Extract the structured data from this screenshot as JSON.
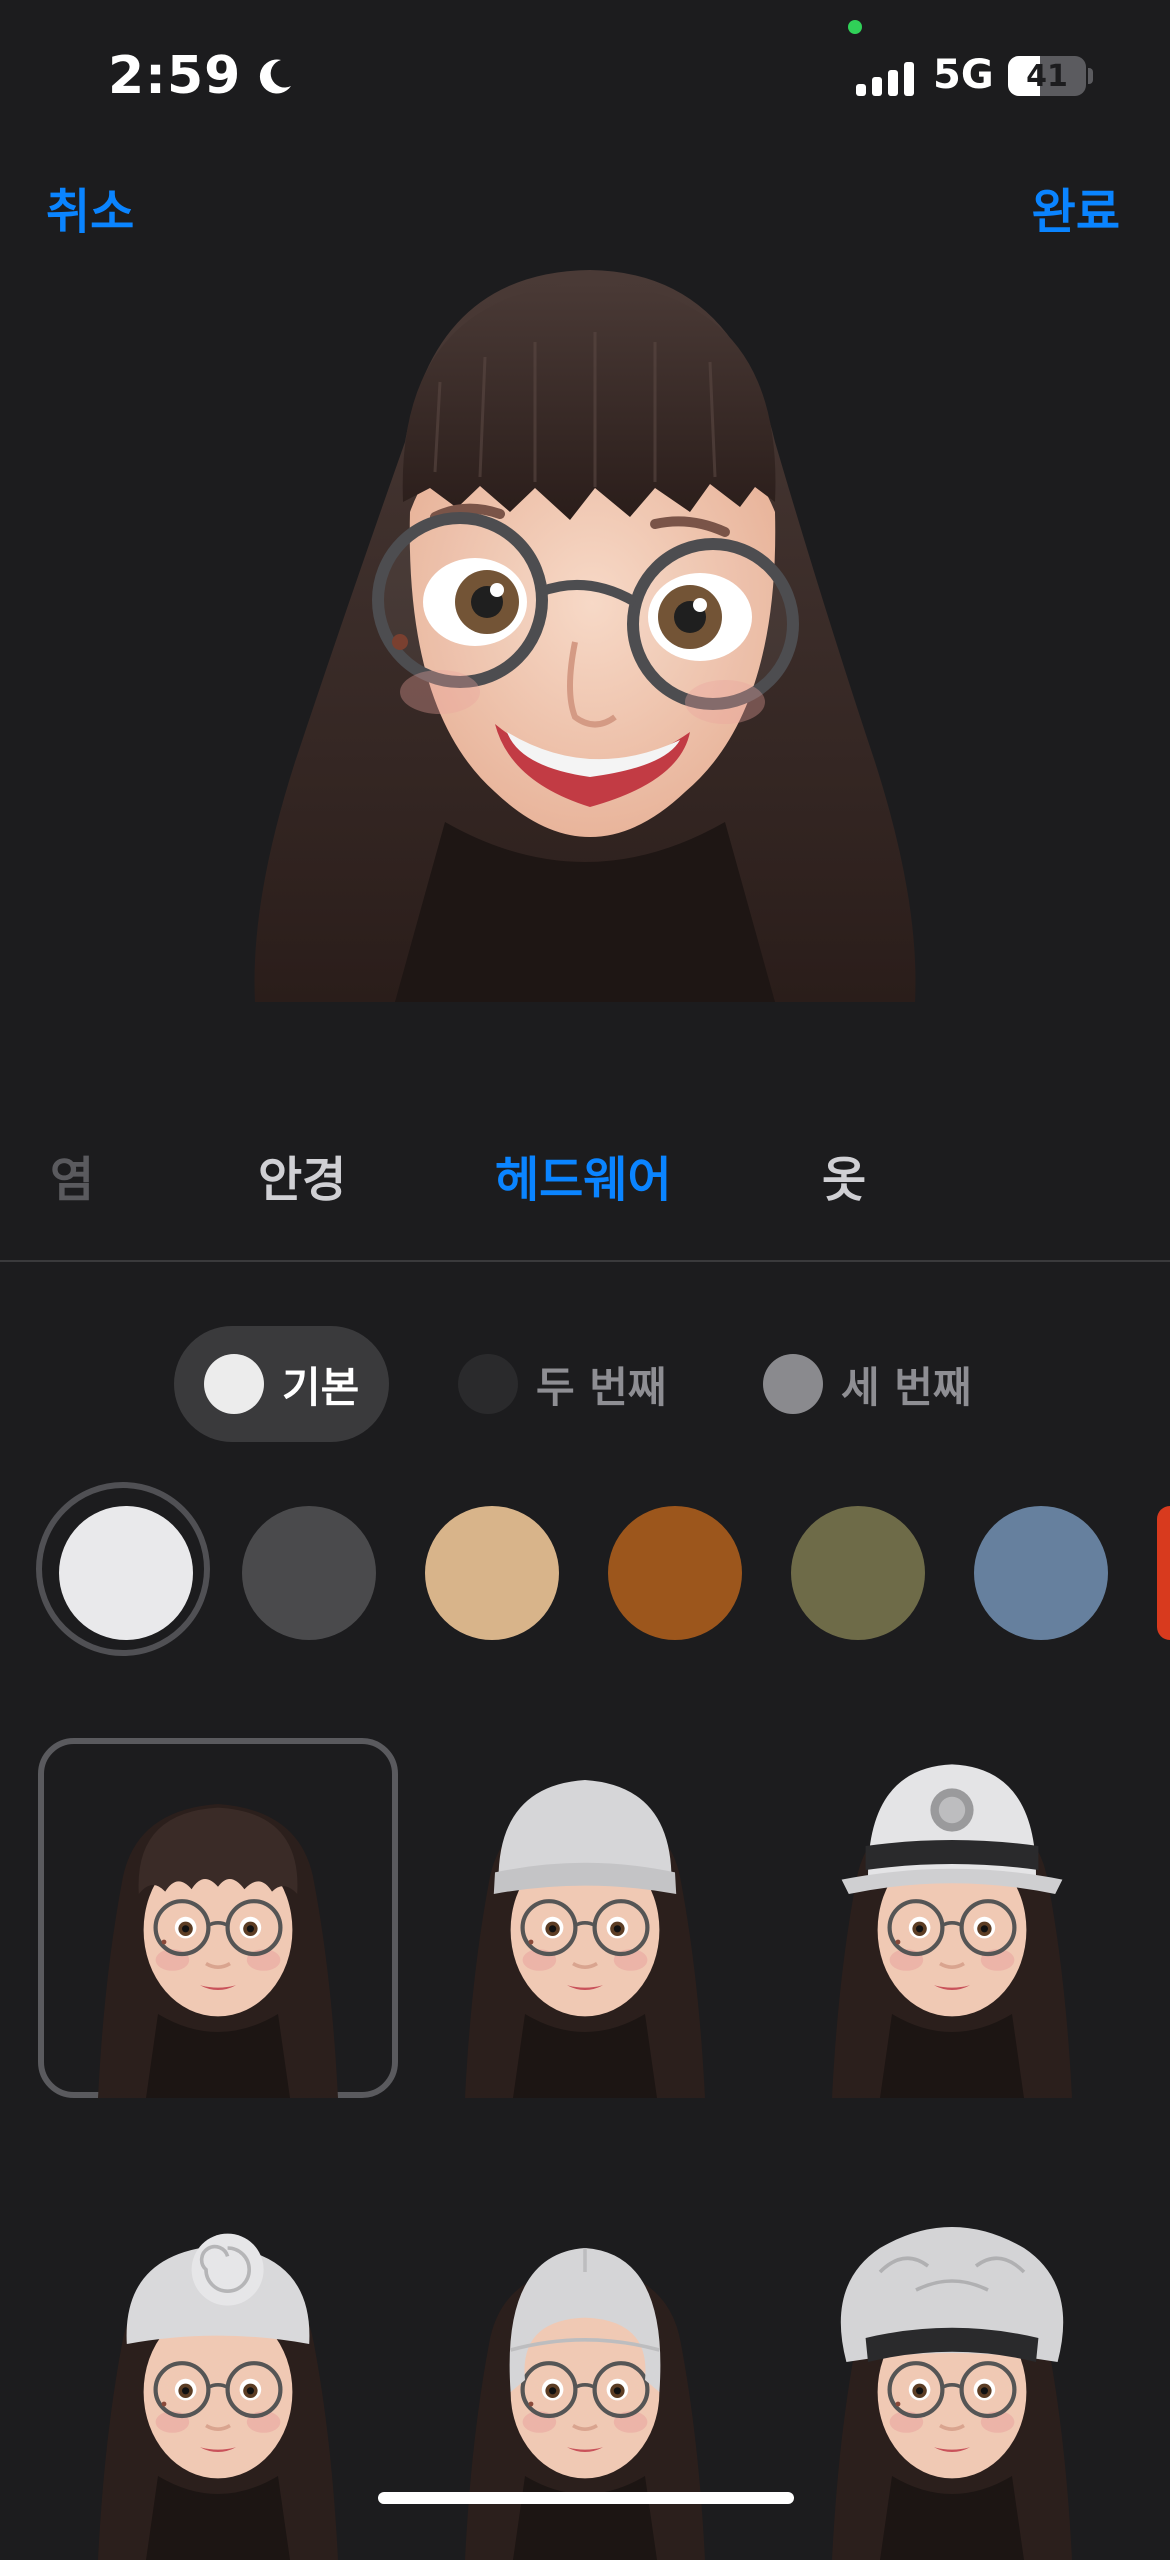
{
  "status_bar": {
    "time": "2:59",
    "network": "5G",
    "battery": 41,
    "battery_label": "41"
  },
  "nav": {
    "cancel": "취소",
    "done": "완료"
  },
  "categories": {
    "prev_partial": "염",
    "glasses": "안경",
    "headwear": "헤드웨어",
    "clothes": "옷"
  },
  "color_slots": [
    {
      "label": "기본",
      "color": "#ececec",
      "selected": true
    },
    {
      "label": "두 번째",
      "color": "#2a2a2c",
      "selected": false
    },
    {
      "label": "세 번째",
      "color": "#8a8a8e",
      "selected": false
    }
  ],
  "swatches": [
    "#e9e9eb",
    "#4a4a4c",
    "#d8b48a",
    "#9c561c",
    "#6e6b48",
    "#66809e",
    "#d83a1e"
  ],
  "headwear_options": [
    {
      "name": "none",
      "selected": true
    },
    {
      "name": "beanie",
      "selected": false
    },
    {
      "name": "helmet",
      "selected": false
    },
    {
      "name": "turban",
      "selected": false
    },
    {
      "name": "skull-cap",
      "selected": false
    },
    {
      "name": "bouffant-cap",
      "selected": false
    }
  ]
}
